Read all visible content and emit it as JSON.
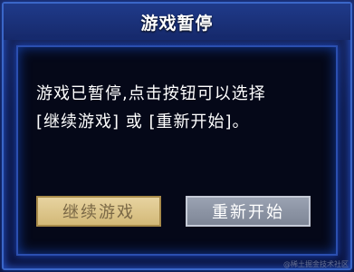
{
  "dialog": {
    "title": "游戏暂停",
    "message_line1": "游戏已暂停,点击按钮可以选择",
    "message_line2": "[继续游戏] 或 [重新开始]。",
    "continue_label": "继续游戏",
    "restart_label": "重新开始"
  },
  "watermark": "@稀土掘金技术社区",
  "colors": {
    "frame": "#3a66c8",
    "title_bar": "#1f3a8a",
    "panel": "#050818",
    "continue_button": "#e0c88f",
    "restart_button": "#8e96a6"
  }
}
